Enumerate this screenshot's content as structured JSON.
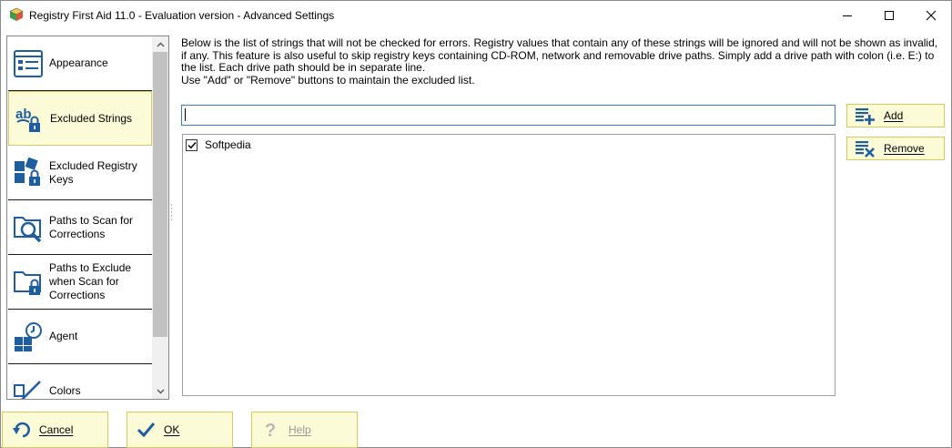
{
  "window": {
    "title": "Registry First Aid 11.0 - Evaluation version - Advanced Settings",
    "app_icon": "cube-app-icon",
    "controls": [
      "minimize-icon",
      "maximize-icon",
      "close-icon"
    ]
  },
  "sidebar": {
    "items": [
      {
        "label": "Appearance",
        "icon": "appearance-window-icon"
      },
      {
        "label": "Excluded Strings",
        "icon": "ab-lock-icon",
        "selected": true
      },
      {
        "label": "Excluded Registry Keys",
        "icon": "registry-blocks-lock-icon"
      },
      {
        "label": "Paths to Scan for Corrections",
        "icon": "folder-magnifier-icon"
      },
      {
        "label": "Paths to Exclude when Scan for Corrections",
        "icon": "folder-lock-icon"
      },
      {
        "label": "Agent",
        "icon": "blocks-clock-icon"
      },
      {
        "label": "Colors",
        "icon": "pen-colors-icon"
      }
    ]
  },
  "main": {
    "description_line1": "Below is the list of strings that will not be checked for errors. Registry values that contain any of these strings will be ignored and will not be shown as invalid, if any.  This feature is also useful to skip registry keys containing CD-ROM, network and removable drive paths. Simply add a drive path with colon (i.e. E:) to the list. Each drive path should be in separate line.",
    "description_line2": "Use \"Add\" or \"Remove\" buttons to maintain the excluded list.",
    "input_value": "",
    "excluded_list": [
      {
        "label": "Softpedia",
        "checked": true
      }
    ],
    "add_label": "Add",
    "remove_label": "Remove"
  },
  "footer": {
    "cancel_label": "Cancel",
    "ok_label": "OK",
    "help_label": "Help"
  },
  "colors": {
    "button_bg": "#fbfbd8",
    "button_border": "#d7c95d",
    "icon_blue": "#1f5e9e",
    "input_border": "#3b7bbf"
  }
}
